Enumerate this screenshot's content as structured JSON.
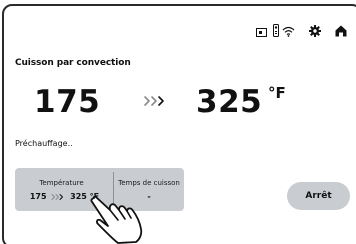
{
  "status_bar": {
    "icons": [
      "card-icon",
      "remote-icon",
      "wifi-icon",
      "gear-icon",
      "home-icon"
    ]
  },
  "cooking": {
    "mode_title": "Cuisson par convection",
    "current_temp": "175",
    "target_temp": "325",
    "unit": "°F",
    "status": "Préchauffage.."
  },
  "settings_panel": {
    "temperature_label": "Température",
    "temperature_current": "175",
    "temperature_target": "325",
    "temperature_unit": "°F",
    "cook_time_label": "Temps de cuisson",
    "cook_time_value": "-"
  },
  "actions": {
    "stop_label": "Arrêt"
  },
  "colors": {
    "panel_bg": "#c9ccd1",
    "frame": "#2a2a2a",
    "text": "#111111"
  }
}
